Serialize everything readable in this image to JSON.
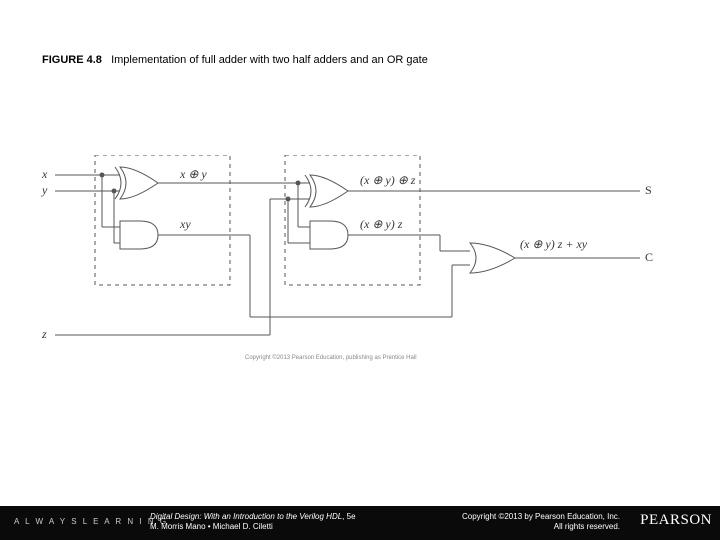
{
  "caption": {
    "prefix": "FIGURE 4.8",
    "text": "Implementation of full adder with two half adders and an OR gate"
  },
  "labels": {
    "x": "x",
    "y": "y",
    "z": "z",
    "xor_xy": "x ⊕ y",
    "and_xy": "xy",
    "xor2": "(x ⊕ y) ⊕ z",
    "and2": "(x ⊕ y) z",
    "carry": "(x ⊕ y) z + xy",
    "S": "S",
    "C": "C"
  },
  "tiny_copyright": "Copyright ©2013 Pearson Education, publishing as Prentice Hall",
  "footer": {
    "always": "A L W A Y S   L E A R N I N G",
    "book_title": "Digital Design: With an Introduction to the Verilog HDL",
    "edition": ", 5e",
    "authors": "M. Morris Mano • Michael D. Ciletti",
    "copyright_line1": "Copyright ©2013 by Pearson Education, Inc.",
    "copyright_line2": "All rights reserved.",
    "brand": "PEARSON"
  }
}
